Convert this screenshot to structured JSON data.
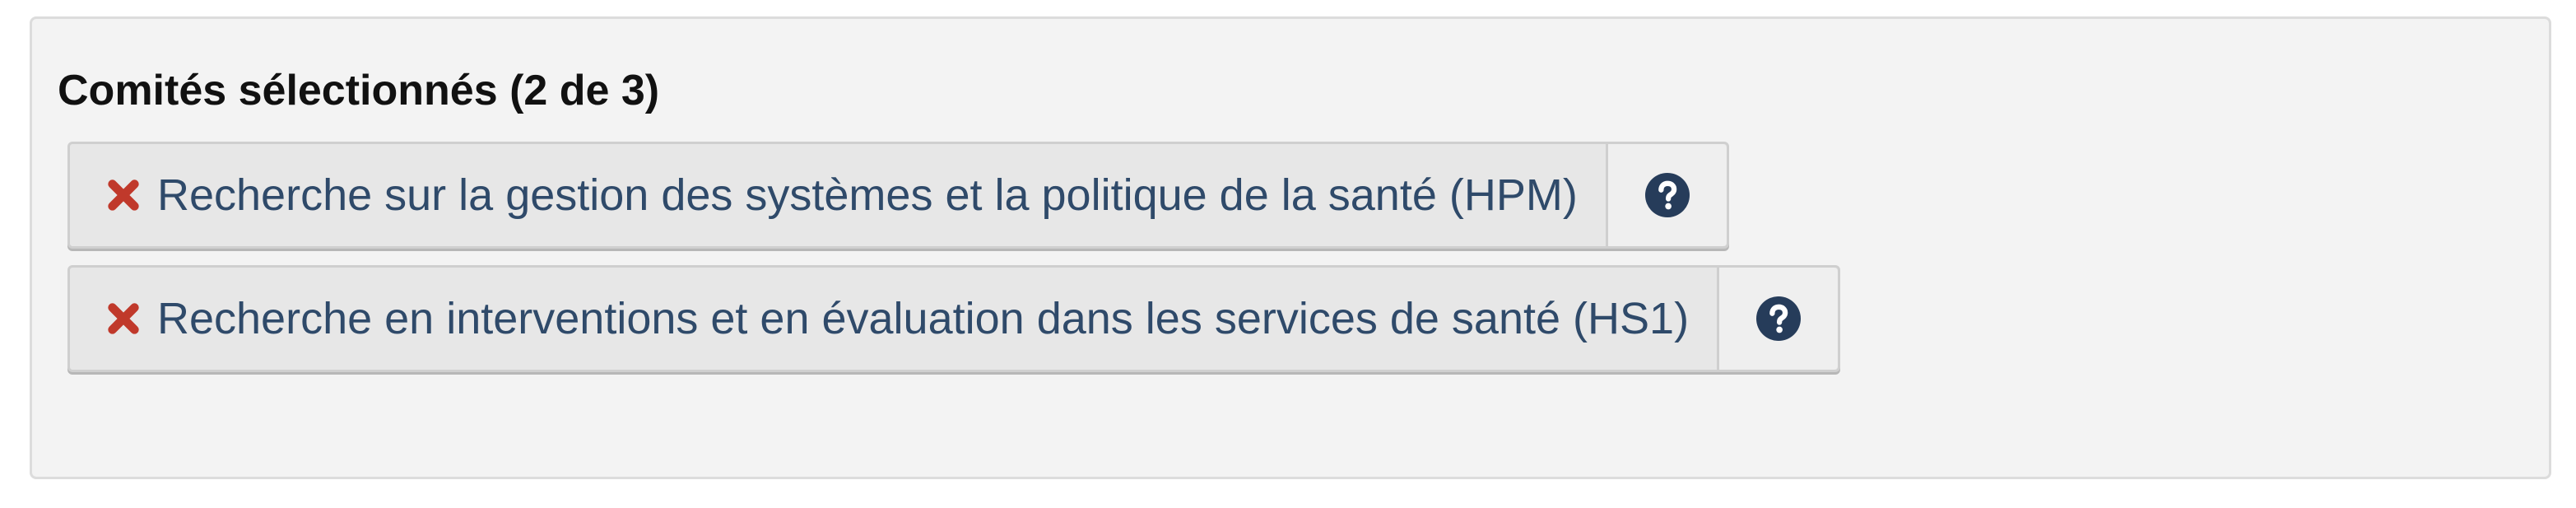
{
  "panel": {
    "title": "Comités sélectionnés (2 de 3)"
  },
  "selected_committees": [
    {
      "label": "Recherche sur la gestion des systèmes et la politique de la santé (HPM)",
      "remove_icon": "remove-x-icon",
      "help_icon": "question-circle-icon"
    },
    {
      "label": "Recherche en interventions et en évaluation dans les services de santé (HS1)",
      "remove_icon": "remove-x-icon",
      "help_icon": "question-circle-icon"
    }
  ],
  "colors": {
    "panel_background": "#f3f3f3",
    "chip_background": "#e7e7e7",
    "label_text": "#2f4a6a",
    "remove_icon": "#c0392b",
    "help_icon": "#263c5a"
  }
}
